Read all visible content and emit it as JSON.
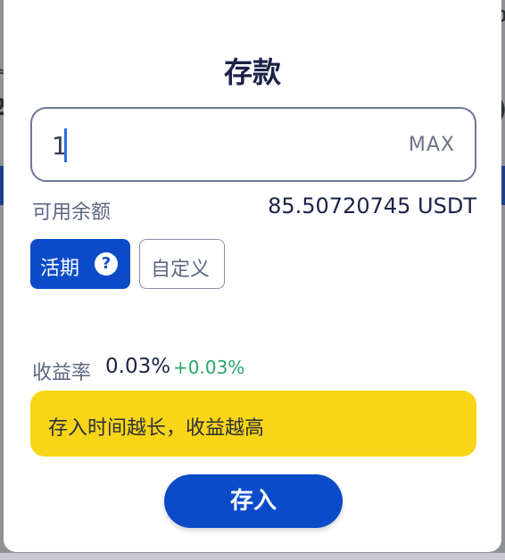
{
  "modal": {
    "title": "存款",
    "amount_input": {
      "value": "1",
      "max_label": "MAX"
    },
    "available": {
      "label": "可用余额",
      "value": "85.50720745 USDT"
    },
    "terms": [
      {
        "label": "活期",
        "selected": true,
        "help_icon": "?"
      },
      {
        "label": "自定义",
        "selected": false
      }
    ],
    "rate": {
      "label": "收益率",
      "value": "0.03%",
      "delta": "+0.03%"
    },
    "tip": "存入时间越长，收益越高",
    "submit_label": "存入"
  },
  "colors": {
    "primary": "#0c4bc8",
    "tip_bg": "#f8d517",
    "positive": "#2aa66a",
    "text_dark": "#1b2347",
    "text_muted": "#5d6782"
  },
  "icons": {
    "help": "question-circle-icon"
  }
}
